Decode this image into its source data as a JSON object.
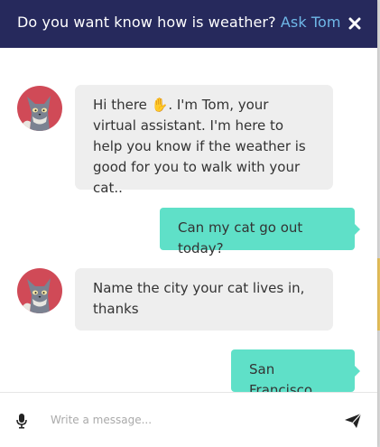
{
  "header": {
    "question": "Do you want know how is weather?",
    "bot_name": "Ask Tom"
  },
  "messages": [
    {
      "sender": "bot",
      "text": "Hi there ✋. I'm Tom, your virtual assistant. I'm here to help you know if the weather is good for you to walk with your cat.."
    },
    {
      "sender": "user",
      "text": "Can my cat go out today?"
    },
    {
      "sender": "bot",
      "text": "Name the city your cat lives in, thanks"
    },
    {
      "sender": "user",
      "text": "San Francisco"
    }
  ],
  "composer": {
    "placeholder": "Write a message..."
  },
  "icons": {
    "close": "close-icon",
    "mic": "microphone-icon",
    "send": "paper-plane-icon",
    "avatar": "cat-avatar"
  },
  "colors": {
    "header_bg": "#26295c",
    "bot_name": "#6fb8e8",
    "bot_bubble": "#eeeeee",
    "user_bubble": "#5fe0c8",
    "avatar_bg": "#d04a57"
  }
}
